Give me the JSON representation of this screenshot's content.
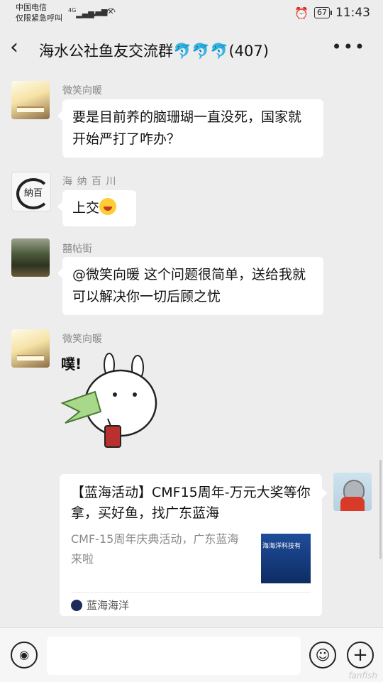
{
  "status": {
    "carrier": "中国电信",
    "emergency": "仅限紧急呼叫",
    "network": "4G",
    "battery": "67",
    "time": "11:43"
  },
  "header": {
    "title": "海水公社鱼友交流群🐬🐬🐬(407)",
    "back_icon": "chevron-left",
    "more_icon": "more-dots",
    "more_text": "•••"
  },
  "messages": [
    {
      "sender": "微笑向暖",
      "text": "要是目前养的脑珊瑚一直没死，国家就开始严打了咋办？"
    },
    {
      "sender": "海 纳 百 川",
      "text": "上交"
    },
    {
      "sender": "囍帖街",
      "text": "@微笑向暖  这个问题很简单，送给我就可以解决你一切后顾之忧"
    },
    {
      "sender": "微笑向暖",
      "sticker_text": "噗!"
    }
  ],
  "share_card": {
    "title": "【蓝海活动】CMF15周年-万元大奖等你拿，买好鱼，找广东蓝海",
    "description": "CMF-15周年庆典活动，广东蓝海来啦",
    "thumb_text": "海海洋科技有",
    "source": "蓝海海洋"
  },
  "input": {
    "voice_icon": "voice",
    "emoji_icon": "emoji",
    "plus_icon": "plus",
    "placeholder": ""
  },
  "watermark": "fanfish",
  "colors": {
    "bg": "#ededed",
    "bubble": "#ffffff",
    "thumb": "#1f4c9a"
  }
}
